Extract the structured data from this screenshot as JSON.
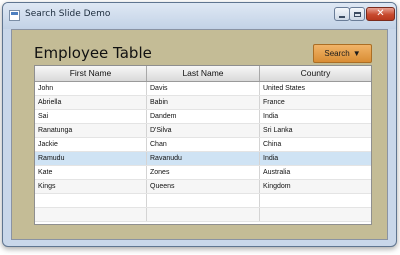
{
  "window": {
    "title": "Search Slide Demo"
  },
  "header": {
    "title": "Employee Table",
    "search_label": "Search"
  },
  "icons": {
    "caret": "caret-down-icon",
    "close": "close-icon"
  },
  "table": {
    "columns": [
      "First Name",
      "Last Name",
      "Country"
    ],
    "rows": [
      [
        "John",
        "Davis",
        "United States"
      ],
      [
        "Abriella",
        "Babin",
        "France"
      ],
      [
        "Sai",
        "Dandem",
        "India"
      ],
      [
        "Ranatunga",
        "D'Silva",
        "Sri Lanka"
      ],
      [
        "Jackie",
        "Chan",
        "China"
      ],
      [
        "Ramudu",
        "Ravanudu",
        "India"
      ],
      [
        "Kate",
        "Zones",
        "Australia"
      ],
      [
        "Kings",
        "Queens",
        "Kingdom"
      ],
      [
        "",
        "",
        ""
      ],
      [
        "",
        "",
        ""
      ]
    ],
    "selected_row": 5
  },
  "colors": {
    "panel_background": "#c4bc96",
    "search_button": "#e39b45",
    "selection": "#cfe3f4"
  }
}
